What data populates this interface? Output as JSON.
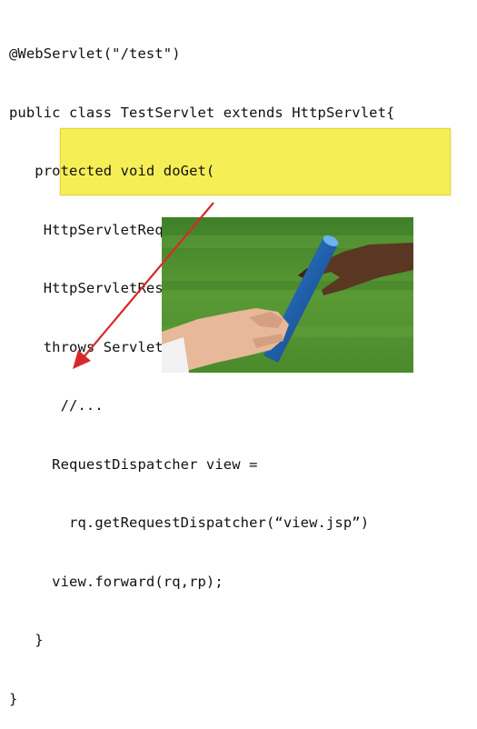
{
  "code_lines": [
    "@WebServlet(\"/test\")",
    "public class TestServlet extends HttpServlet{",
    "   protected void doGet(",
    "    HttpServletRequest rq,",
    "    HttpServletResponse rp)",
    "    throws ServletException, IOException {",
    "      //...",
    "     RequestDispatcher view =",
    "       rq.getRequestDispatcher(“view.jsp”)",
    "     view.forward(rq,rp);",
    "   }",
    "}"
  ],
  "colors": {
    "highlight": "#f6ee55",
    "arrow": "#d62a2a",
    "grass": "#4f8f2e",
    "baton": "#1f5fa8"
  },
  "image": {
    "subject": "relay-baton-handoff"
  }
}
